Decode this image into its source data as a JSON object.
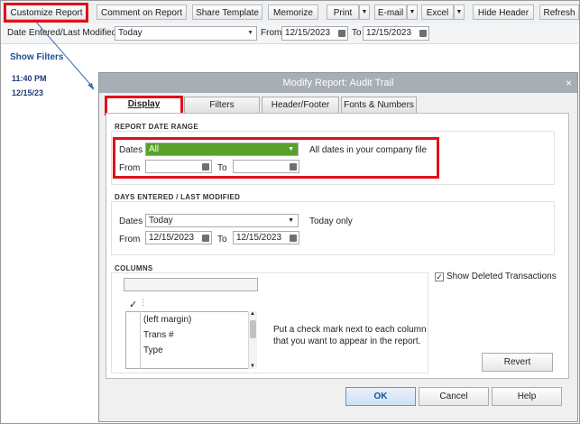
{
  "toolbar": {
    "customize": "Customize Report",
    "comment": "Comment on Report",
    "share": "Share Template",
    "memorize": "Memorize",
    "print": "Print",
    "email": "E-mail",
    "excel": "Excel",
    "hide_header": "Hide Header",
    "refresh": "Refresh"
  },
  "filterbar": {
    "date_label": "Date Entered/Last Modified",
    "date_value": "Today",
    "from_label": "From",
    "from_value": "12/15/2023",
    "to_label": "To",
    "to_value": "12/15/2023"
  },
  "left": {
    "show_filters": "Show Filters",
    "time": "11:40 PM",
    "date": "12/15/23"
  },
  "dialog": {
    "title": "Modify Report: Audit Trail",
    "close": "×",
    "tabs": [
      "Display",
      "Filters",
      "Header/Footer",
      "Fonts & Numbers"
    ],
    "report_date_range": {
      "title": "REPORT DATE RANGE",
      "dates_label": "Dates",
      "dates_value": "All",
      "dates_note": "All dates in your company file",
      "from_label": "From",
      "to_label": "To"
    },
    "days_entered": {
      "title": "DAYS ENTERED / LAST MODIFIED",
      "dates_label": "Dates",
      "dates_value": "Today",
      "dates_note": "Today only",
      "from_label": "From",
      "from_value": "12/15/2023",
      "to_label": "To",
      "to_value": "12/15/2023"
    },
    "columns": {
      "title": "COLUMNS",
      "check_header": "✓",
      "items": [
        "(left margin)",
        "Trans #",
        "Type"
      ],
      "instructions_line1": "Put a check mark next to each column",
      "instructions_line2": "that you want to appear in the report."
    },
    "show_deleted": "Show Deleted Transactions",
    "show_deleted_checked": "✓",
    "revert": "Revert",
    "ok": "OK",
    "cancel": "Cancel",
    "help": "Help"
  },
  "colors": {
    "highlight": "#e0101a",
    "selected_green": "#5aa02c",
    "title_bar": "#a7aeb6",
    "link_blue": "#1f4f96"
  }
}
